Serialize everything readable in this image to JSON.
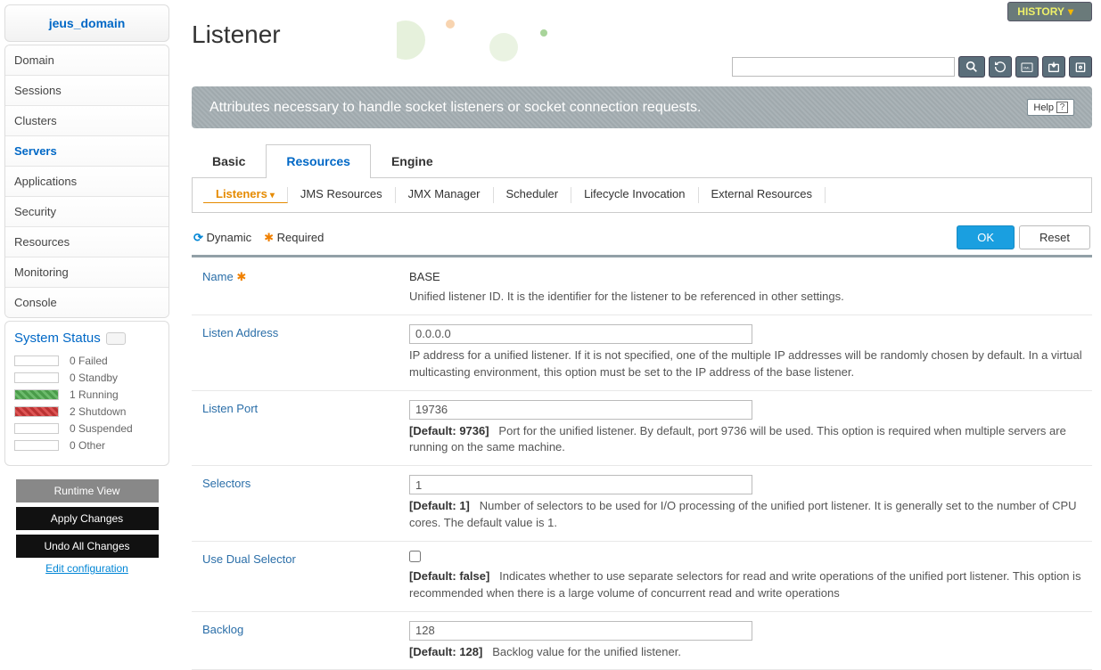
{
  "domain_name": "jeus_domain",
  "nav": [
    "Domain",
    "Sessions",
    "Clusters",
    "Servers",
    "Applications",
    "Security",
    "Resources",
    "Monitoring",
    "Console"
  ],
  "nav_active": "Servers",
  "status": {
    "title": "System Status",
    "items": [
      {
        "count": 0,
        "label": "Failed",
        "cls": ""
      },
      {
        "count": 0,
        "label": "Standby",
        "cls": ""
      },
      {
        "count": 1,
        "label": "Running",
        "cls": "running"
      },
      {
        "count": 2,
        "label": "Shutdown",
        "cls": "shutdown"
      },
      {
        "count": 0,
        "label": "Suspended",
        "cls": ""
      },
      {
        "count": 0,
        "label": "Other",
        "cls": ""
      }
    ]
  },
  "sidebar_buttons": {
    "runtime": "Runtime View",
    "apply": "Apply Changes",
    "undo": "Undo All Changes",
    "edit": "Edit configuration"
  },
  "history_label": "HISTORY",
  "page_title": "Listener",
  "search_value": "",
  "banner": "Attributes necessary to handle socket listeners or socket connection requests.",
  "help_label": "Help",
  "tabs": [
    "Basic",
    "Resources",
    "Engine"
  ],
  "tabs_active": "Resources",
  "subtabs": [
    "Listeners",
    "JMS Resources",
    "JMX Manager",
    "Scheduler",
    "Lifecycle Invocation",
    "External Resources"
  ],
  "subtabs_active": "Listeners",
  "legend": {
    "dynamic": "Dynamic",
    "required": "Required"
  },
  "buttons": {
    "ok": "OK",
    "reset": "Reset"
  },
  "fields": {
    "name": {
      "label": "Name",
      "value": "BASE",
      "desc": "Unified listener ID. It is the identifier for the listener to be referenced in other settings."
    },
    "listen_address": {
      "label": "Listen Address",
      "value": "0.0.0.0",
      "desc": "IP address for a unified listener. If it is not specified, one of the multiple IP addresses will be randomly chosen by default. In a virtual multicasting environment, this option must be set to the IP address of the base listener."
    },
    "listen_port": {
      "label": "Listen Port",
      "value": "19736",
      "default": "[Default: 9736]",
      "desc": "Port for the unified listener. By default, port 9736 will be used. This option is required when multiple servers are running on the same machine."
    },
    "selectors": {
      "label": "Selectors",
      "value": "1",
      "default": "[Default: 1]",
      "desc": "Number of selectors to be used for I/O processing of the unified port listener. It is generally set to the number of CPU cores. The default value is 1."
    },
    "use_dual": {
      "label": "Use Dual Selector",
      "checked": false,
      "default": "[Default: false]",
      "desc": "Indicates whether to use separate selectors for read and write operations of the unified port listener. This option is recommended when there is a large volume of concurrent read and write operations"
    },
    "backlog": {
      "label": "Backlog",
      "value": "128",
      "default": "[Default: 128]",
      "desc": "Backlog value for the unified listener."
    }
  }
}
